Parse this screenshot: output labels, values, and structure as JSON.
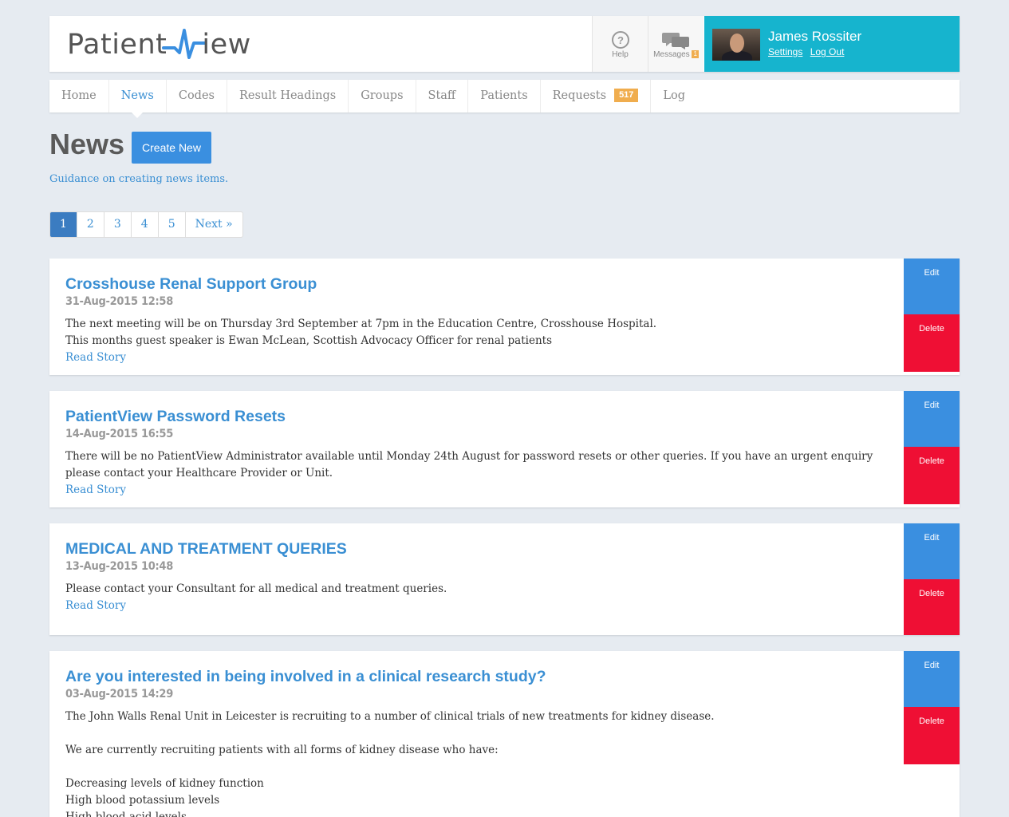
{
  "header": {
    "logo_left": "Patient",
    "logo_right": "iew",
    "help_label": "Help",
    "messages_label": "Messages",
    "messages_count": "1",
    "user_name": "James Rossiter",
    "settings_link": "Settings",
    "logout_link": "Log Out"
  },
  "nav": {
    "items": [
      "Home",
      "News",
      "Codes",
      "Result Headings",
      "Groups",
      "Staff",
      "Patients",
      "Requests",
      "Log"
    ],
    "requests_badge": "517",
    "active": "News"
  },
  "page": {
    "title": "News",
    "create_button": "Create New",
    "guidance_link": "Guidance on creating news items."
  },
  "pagination": {
    "pages": [
      "1",
      "2",
      "3",
      "4",
      "5"
    ],
    "next": "Next »",
    "current": "1"
  },
  "news": [
    {
      "title": "Crosshouse Renal Support Group",
      "date": "31-Aug-2015 12:58",
      "lines": [
        "The next meeting will be on Thursday 3rd September at 7pm in the Education Centre, Crosshouse Hospital.",
        "This months guest speaker is Ewan McLean, Scottish Advocacy Officer for renal patients"
      ],
      "read_more": "Read Story"
    },
    {
      "title": "PatientView Password Resets",
      "date": "14-Aug-2015 16:55",
      "lines": [
        "There will be no PatientView Administrator available until Monday 24th August for password resets or other queries. If you have an urgent enquiry please contact your Healthcare Provider or Unit."
      ],
      "read_more": "Read Story"
    },
    {
      "title": "MEDICAL AND TREATMENT QUERIES",
      "date": "13-Aug-2015 10:48",
      "lines": [
        "Please contact your Consultant for all medical and treatment queries."
      ],
      "read_more": "Read Story"
    },
    {
      "title": "Are you interested in being involved in a clinical research study?",
      "date": "03-Aug-2015 14:29",
      "lines": [
        "The John Walls Renal Unit in Leicester is recruiting to a number of clinical trials of new treatments for kidney disease.",
        "",
        "We are currently recruiting patients with all forms of kidney disease who have:",
        "",
        "Decreasing levels of kidney function",
        "High blood potassium levels",
        "High blood acid levels"
      ],
      "read_more": ""
    }
  ],
  "actions": {
    "edit": "Edit",
    "delete": "Delete"
  },
  "colors": {
    "accent": "#3a8fe0",
    "user_box": "#16b4ce",
    "delete": "#ef0f34",
    "badge": "#f0ad4e"
  }
}
